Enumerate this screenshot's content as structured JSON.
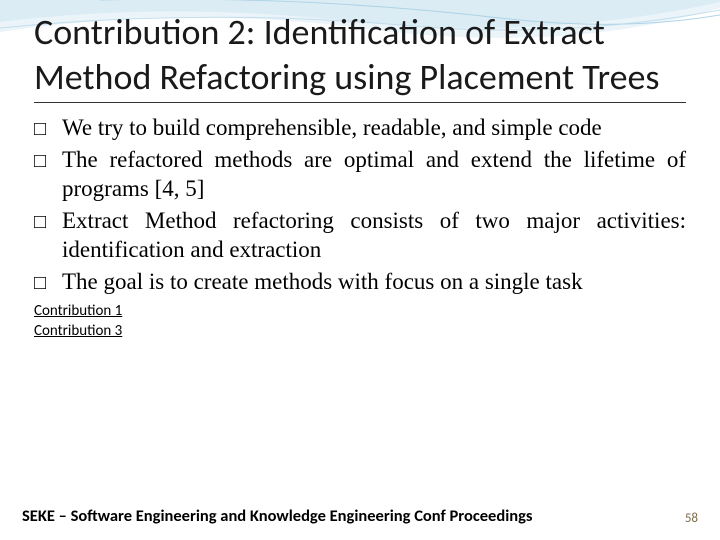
{
  "title": "Contribution 2: Identification of Extract Method Refactoring using Placement Trees",
  "bullets": [
    "We try to build comprehensible, readable, and simple code",
    "The refactored methods are optimal and extend the lifetime of programs [4, 5]",
    "Extract Method refactoring consists of two major activities: identification and extraction",
    "The goal is to create methods with focus on a single task"
  ],
  "links": {
    "contribution1": "Contribution 1",
    "contribution3": "Contribution 3"
  },
  "footer": {
    "text": "SEKE – Software Engineering and Knowledge Engineering Conf Proceedings",
    "page": "58"
  }
}
